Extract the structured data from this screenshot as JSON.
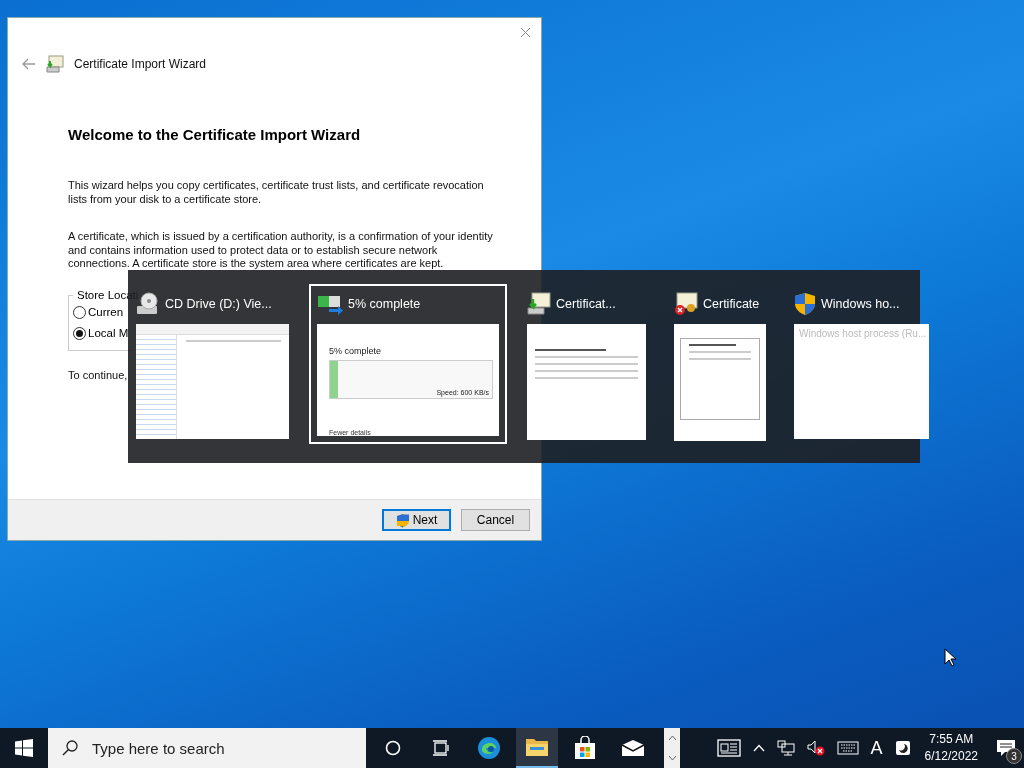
{
  "wizard": {
    "title": "Certificate Import Wizard",
    "heading": "Welcome to the Certificate Import Wizard",
    "paragraphs": [
      "This wizard helps you copy certificates, certificate trust lists, and certificate revocation lists from your disk to a certificate store.",
      "A certificate, which is issued by a certification authority, is a confirmation of your identity and contains information used to protect data or to establish secure network connections. A certificate store is the system area where certificates are kept."
    ],
    "store_location": {
      "label": "Store Locati",
      "options": [
        {
          "label": "Curren",
          "selected": false
        },
        {
          "label": "Local M",
          "selected": true
        }
      ]
    },
    "continue_text": "To continue,",
    "buttons": [
      {
        "label": "Next",
        "kind": "primary"
      },
      {
        "label": "Cancel",
        "kind": "secondary"
      }
    ]
  },
  "task_switcher": {
    "items": [
      {
        "title": "CD Drive (D:) Vie...",
        "kind": "explorer",
        "selected": false
      },
      {
        "title": "5% complete",
        "kind": "progress",
        "selected": true,
        "preview": {
          "status": "5% complete",
          "level": 0.05,
          "speed": "Speed: 600 KB/s",
          "details": "Fewer details"
        }
      },
      {
        "title": "Certificat...",
        "kind": "wizard",
        "selected": false
      },
      {
        "title": "Certificate",
        "kind": "certificate",
        "selected": false
      },
      {
        "title": "Windows ho...",
        "kind": "host",
        "selected": false,
        "preview": {
          "caption": "Windows host process (Ru..."
        }
      }
    ]
  },
  "taskbar": {
    "search": {
      "placeholder": "Type here to search"
    },
    "apps": [
      {
        "kind": "cortana",
        "active": false
      },
      {
        "kind": "taskview",
        "active": false
      },
      {
        "kind": "edge",
        "active": false
      },
      {
        "kind": "explorer",
        "active": true
      },
      {
        "kind": "store",
        "active": false
      },
      {
        "kind": "mail",
        "active": false
      }
    ],
    "ime_label": "A",
    "time": "7:55 AM",
    "date": "6/12/2022",
    "notification_count": "3"
  }
}
